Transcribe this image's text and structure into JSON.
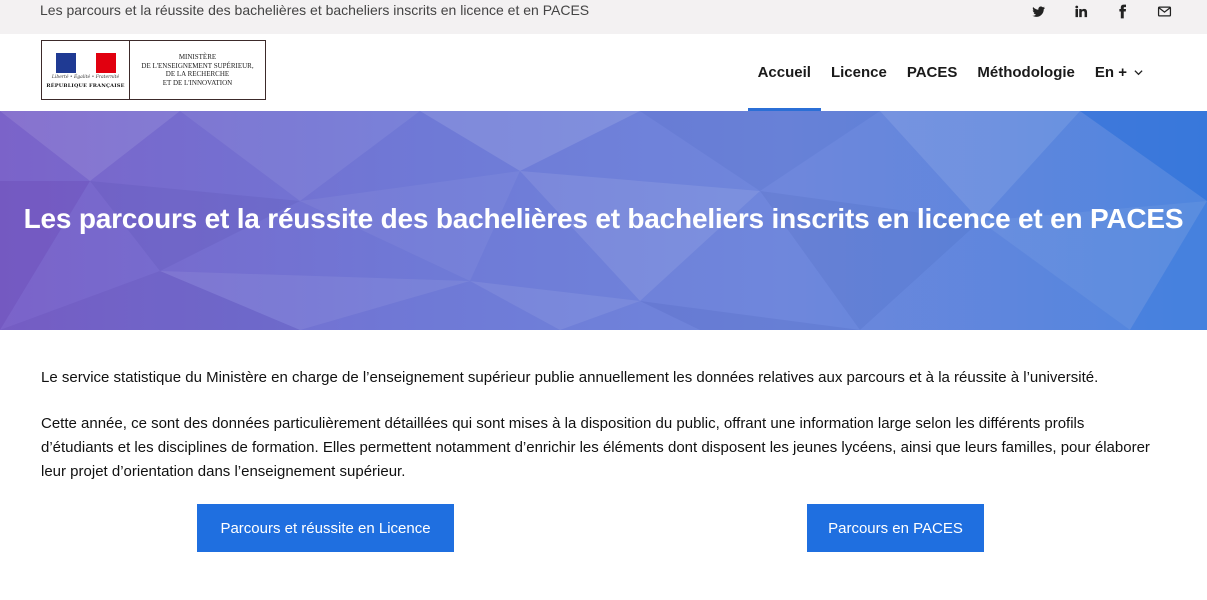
{
  "topbar": {
    "title": "Les parcours et la réussite des bachelières et bacheliers inscrits en licence et en PACES",
    "social": [
      {
        "icon": "twitter-icon",
        "label": "Twitter"
      },
      {
        "icon": "linkedin-icon",
        "label": "LinkedIn"
      },
      {
        "icon": "facebook-icon",
        "label": "Facebook"
      },
      {
        "icon": "mail-icon",
        "label": "Email"
      }
    ]
  },
  "logo": {
    "motto": "Liberté • Égalité • Fraternité",
    "republique": "RÉPUBLIQUE FRANÇAISE",
    "ministry_line1": "MINISTÈRE",
    "ministry_line2": "DE L'ENSEIGNEMENT SUPÉRIEUR,",
    "ministry_line3": "DE LA RECHERCHE",
    "ministry_line4": "ET DE L'INNOVATION"
  },
  "nav": {
    "items": [
      {
        "label": "Accueil",
        "active": true
      },
      {
        "label": "Licence",
        "active": false
      },
      {
        "label": "PACES",
        "active": false
      },
      {
        "label": "Méthodologie",
        "active": false
      },
      {
        "label": "En +",
        "active": false
      }
    ]
  },
  "hero": {
    "title": "Les parcours et la réussite des bachelières et bacheliers inscrits en licence et en PACES"
  },
  "main": {
    "paragraph1": "Le service statistique du Ministère en charge de l’enseignement supérieur publie annuellement les données relatives aux parcours et à la réussite à l’université.",
    "paragraph2": "Cette année, ce sont des données particulièrement détaillées qui sont mises à la disposition du public, offrant une information large selon les différents profils d’étudiants et les disciplines de formation. Elles permettent notamment d’enrichir les éléments dont disposent les jeunes lycéens, ainsi que leurs familles, pour élaborer leur projet d’orientation dans l’enseignement supérieur.",
    "button_licence": "Parcours et réussite en Licence",
    "button_paces": "Parcours en PACES"
  },
  "colors": {
    "accent": "#1f6fe0",
    "nav_underline": "#2b6fd6",
    "topbar_bg": "#f3f1f2"
  }
}
